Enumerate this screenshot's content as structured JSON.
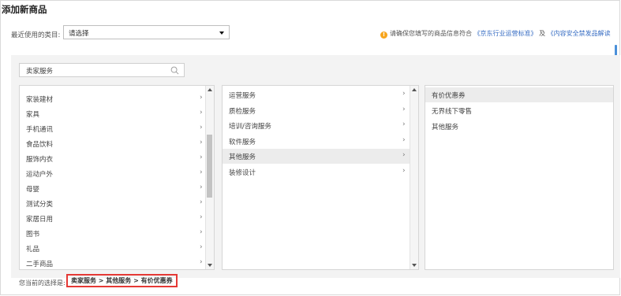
{
  "page": {
    "title": "添加新商品"
  },
  "recent": {
    "label": "最近使用的类目:",
    "selected": "请选择"
  },
  "notice": {
    "text_before": "请确保您填写的商品信息符合",
    "link1": "《京东行业运营标准》",
    "and": "及",
    "link2": "《内容安全禁发品解读"
  },
  "search": {
    "value": "卖家服务"
  },
  "col1": {
    "items": [
      "家装建材",
      "家具",
      "手机通讯",
      "食品饮料",
      "服饰内衣",
      "运动户外",
      "母婴",
      "测试分类",
      "家居日用",
      "图书",
      "礼品",
      "二手商品"
    ]
  },
  "col2": {
    "items": [
      "运营服务",
      "质检服务",
      "培训/咨询服务",
      "软件服务",
      "其他服务",
      "装修设计"
    ],
    "selected_index": 4
  },
  "col3": {
    "items": [
      "有价优惠券",
      "无界线下零售",
      "其他服务"
    ],
    "selected_index": 0
  },
  "selection": {
    "label": "您当前的选择是:",
    "path": [
      "卖家服务",
      "其他服务",
      "有价优惠券"
    ],
    "separator": ">"
  }
}
